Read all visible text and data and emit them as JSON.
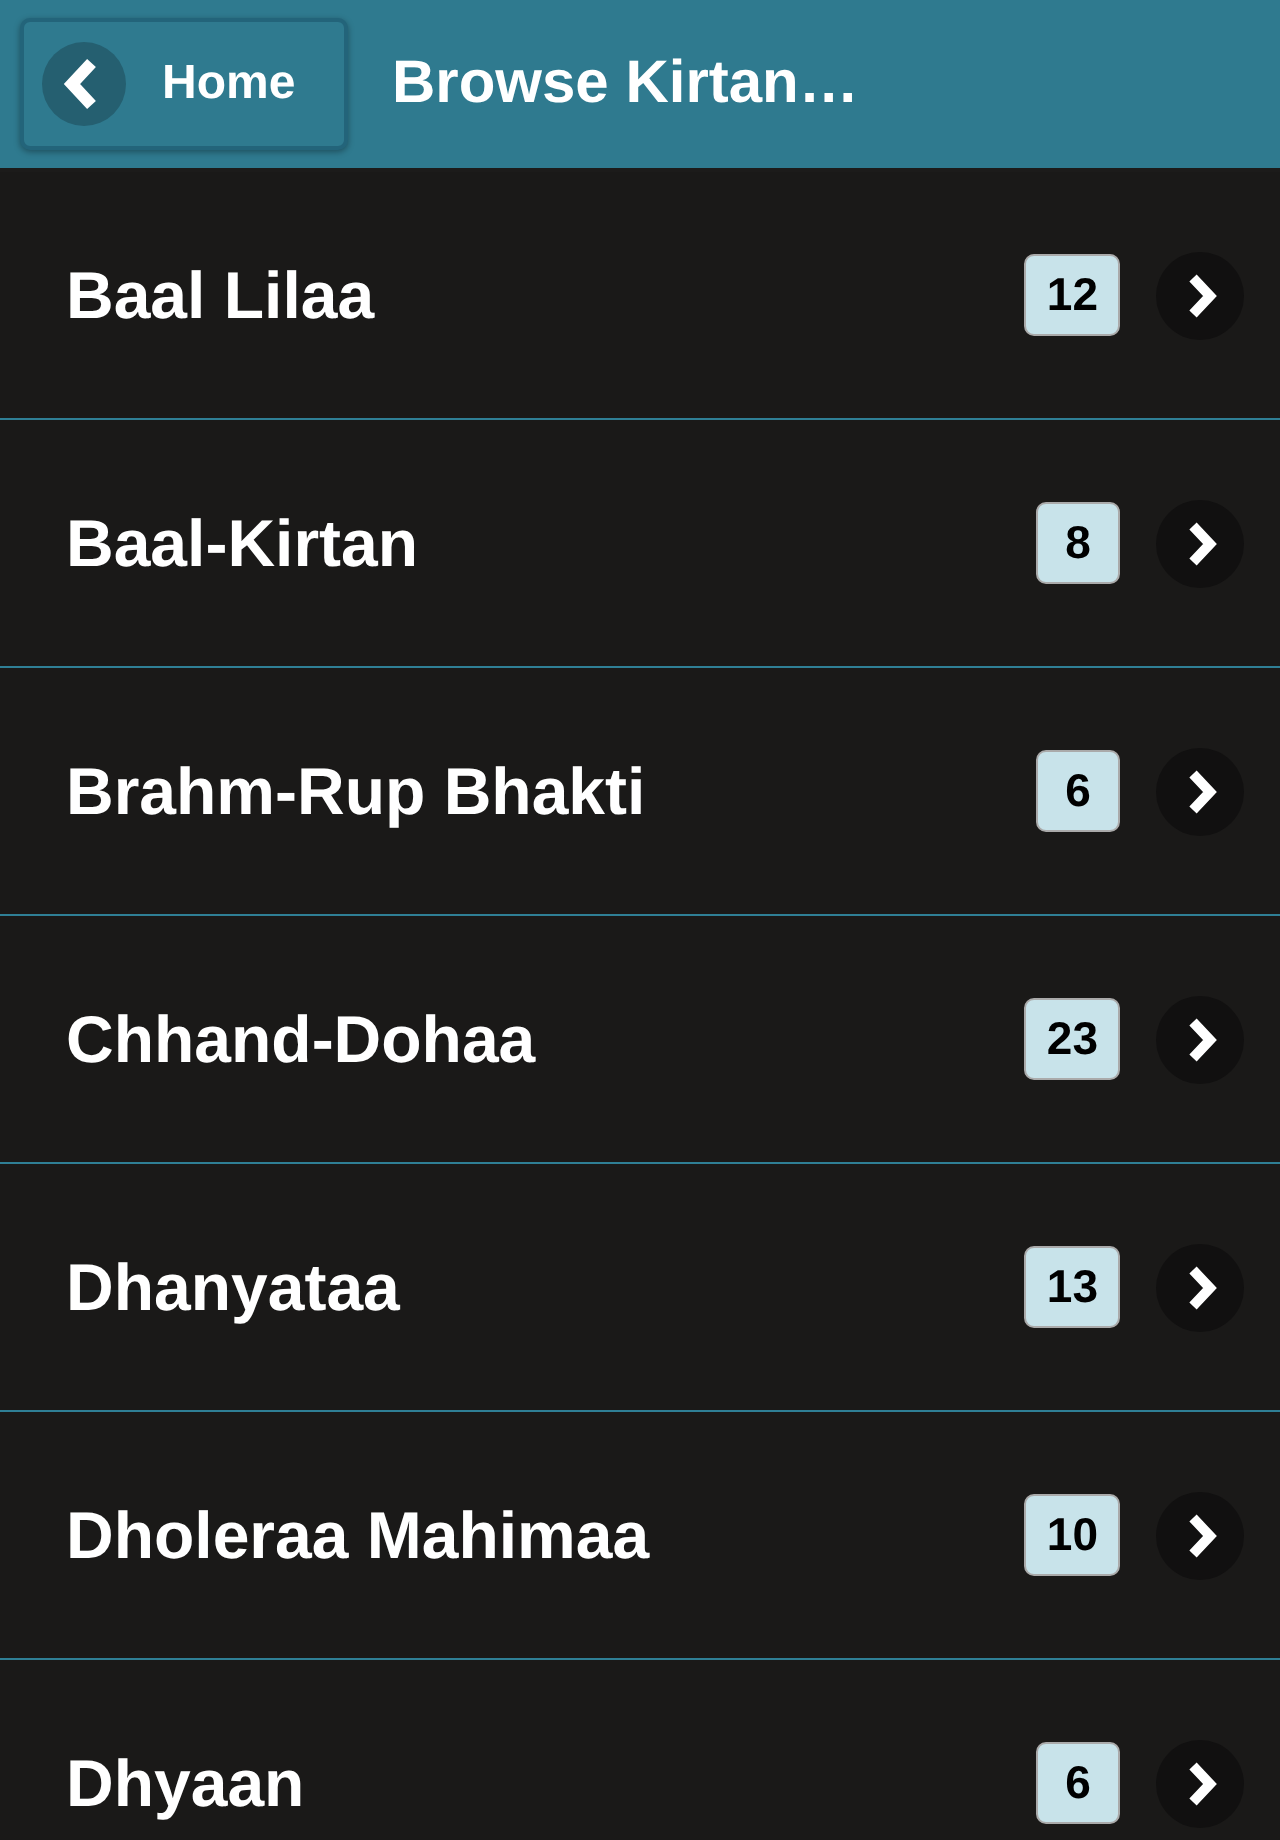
{
  "header": {
    "back_button": "Home",
    "title": "Browse Kirtan…"
  },
  "items": [
    {
      "label": "Baal Lilaa",
      "count": "12"
    },
    {
      "label": "Baal-Kirtan",
      "count": "8"
    },
    {
      "label": "Brahm-Rup Bhakti",
      "count": "6"
    },
    {
      "label": "Chhand-Dohaa",
      "count": "23"
    },
    {
      "label": "Dhanyataa",
      "count": "13"
    },
    {
      "label": "Dholeraa Mahimaa",
      "count": "10"
    },
    {
      "label": "Dhyaan",
      "count": "6"
    }
  ]
}
